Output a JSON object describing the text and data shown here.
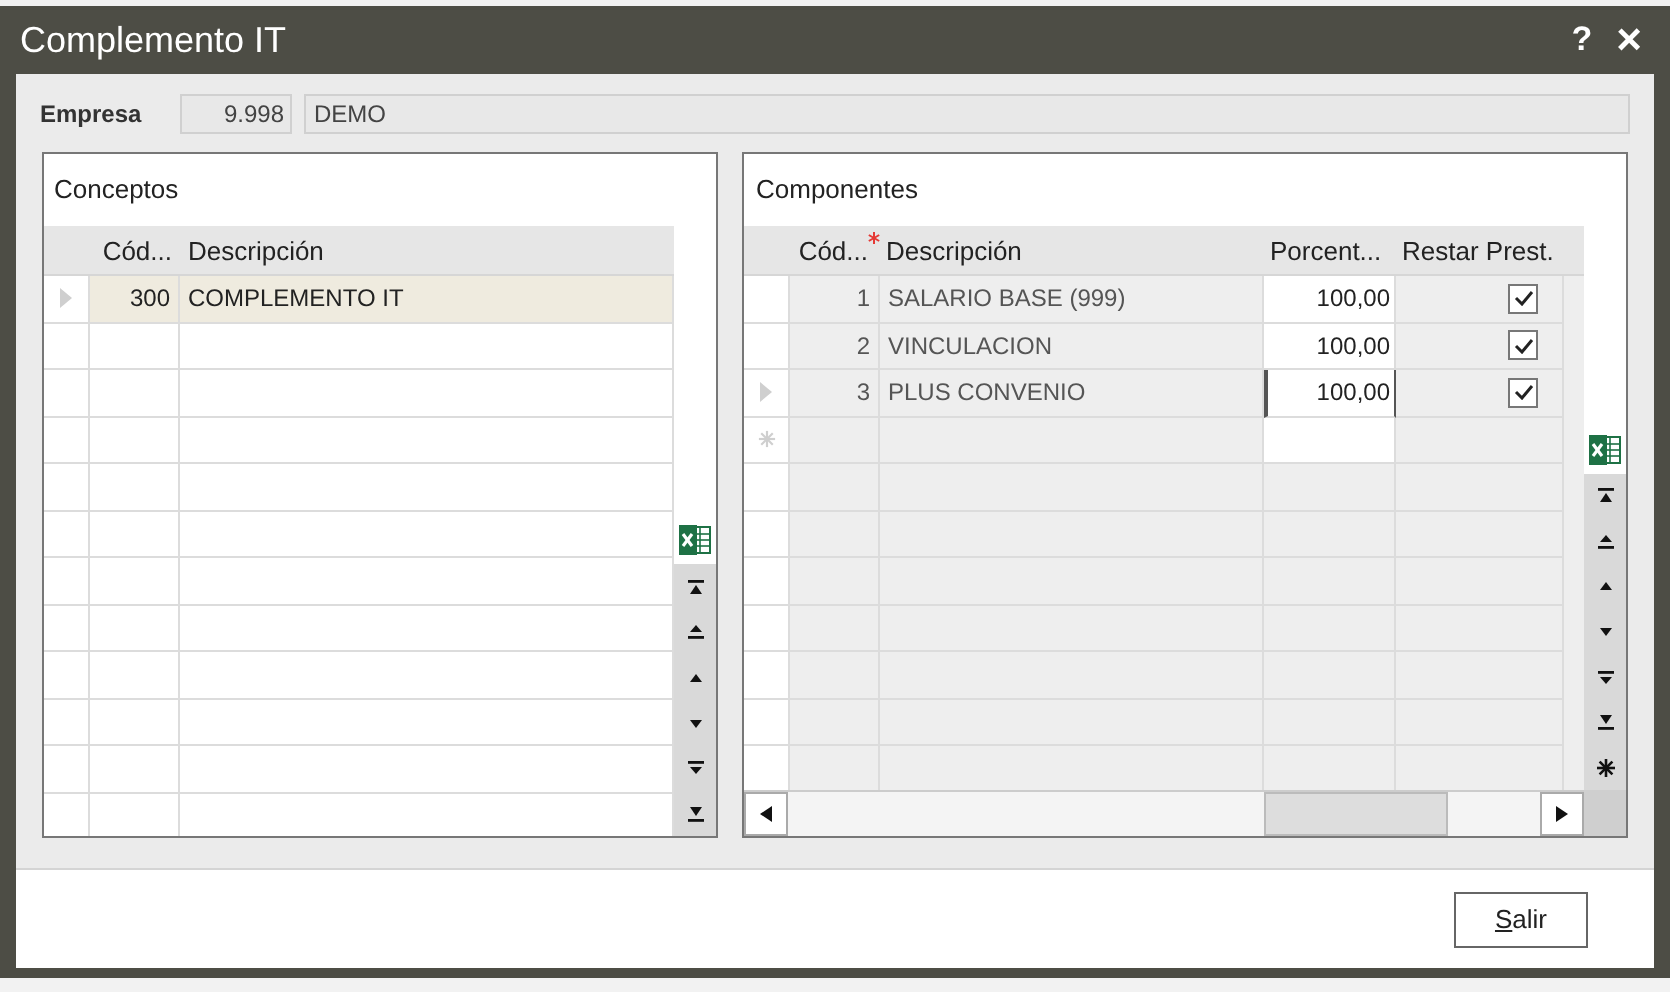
{
  "window": {
    "title": "Complemento IT",
    "help": "?",
    "close": "×"
  },
  "empresa": {
    "label": "Empresa",
    "code": "9.998",
    "name": "DEMO"
  },
  "conceptos": {
    "title": "Conceptos",
    "columns": [
      "Cód...",
      "Descripción"
    ],
    "rows": [
      {
        "code": "300",
        "description": "COMPLEMENTO IT",
        "selected": true
      }
    ]
  },
  "componentes": {
    "title": "Componentes",
    "columns": [
      {
        "label": "Cód...",
        "required": true
      },
      {
        "label": "Descripción",
        "required": false
      },
      {
        "label": "Porcent...",
        "required": false
      },
      {
        "label": "Restar Prest.",
        "required": false
      }
    ],
    "rows": [
      {
        "code": "1",
        "description": "SALARIO BASE (999)",
        "percent": "100,00",
        "checked": true,
        "selected": false
      },
      {
        "code": "2",
        "description": "VINCULACION",
        "percent": "100,00",
        "checked": true,
        "selected": false
      },
      {
        "code": "3",
        "description": "PLUS CONVENIO",
        "percent": "100,00",
        "checked": true,
        "selected": true
      }
    ]
  },
  "footer": {
    "button": "Salir"
  }
}
